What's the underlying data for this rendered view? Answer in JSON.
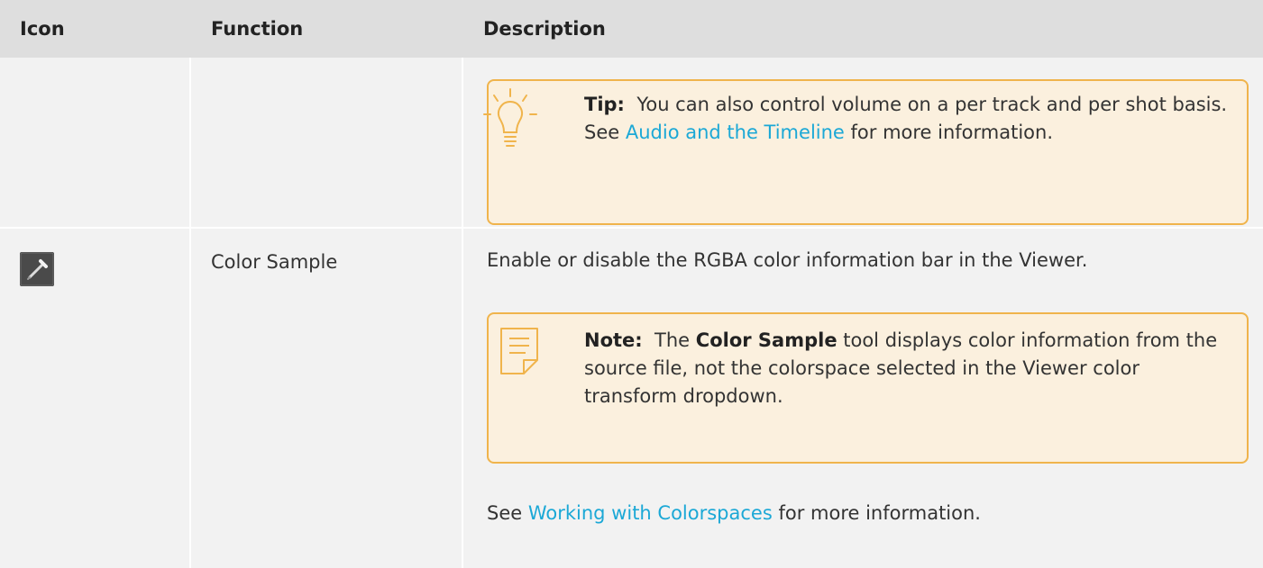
{
  "table": {
    "headers": {
      "icon": "Icon",
      "function": "Function",
      "description": "Description"
    }
  },
  "row1": {
    "tip": {
      "label": "Tip:",
      "text_before": "You can also control volume on a per track and per shot basis. See ",
      "link": "Audio and the Timeline",
      "text_after": " for more information.",
      "icon": "lightbulb-icon"
    }
  },
  "row2": {
    "icon": "color-picker-icon",
    "function": "Color Sample",
    "description": "Enable or disable the RGBA color information bar in the Viewer.",
    "note": {
      "label": "Note:",
      "text_before": "The ",
      "bold": "Color Sample",
      "text_after": " tool displays color information from the source file, not the colorspace selected in the Viewer color transform dropdown.",
      "icon": "note-icon"
    },
    "see": {
      "before": "See ",
      "link": "Working with Colorspaces",
      "after": " for more information."
    }
  },
  "colors": {
    "header_bg": "#dedede",
    "cell_bg": "#f2f2f2",
    "callout_border": "#f0b44c",
    "callout_bg": "#fbf0de",
    "link": "#1ba8d6"
  }
}
